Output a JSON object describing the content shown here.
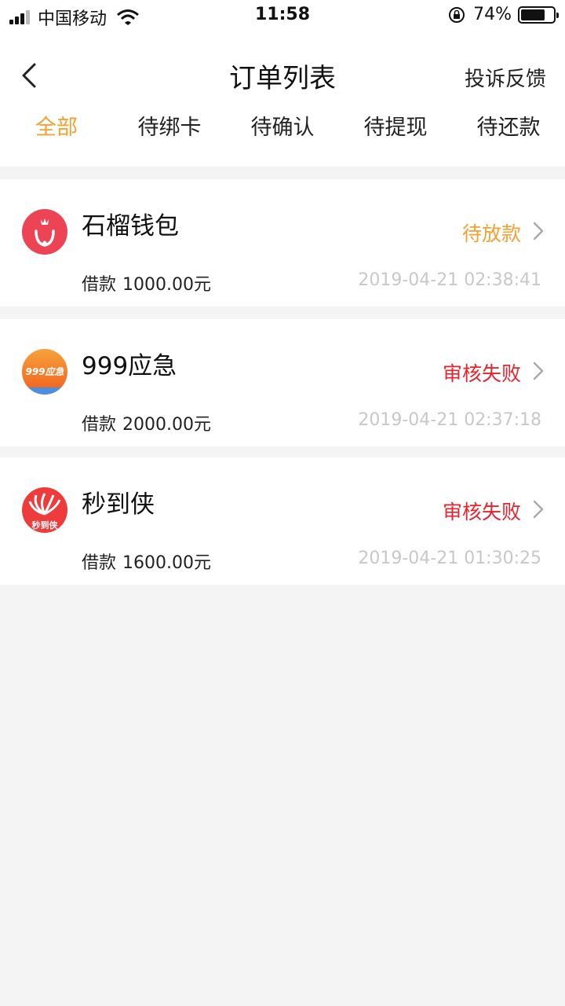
{
  "status_bar": {
    "carrier": "中国移动",
    "time": "11:58",
    "battery": "74%",
    "battery_level": 0.74
  },
  "header": {
    "title": "订单列表",
    "feedback": "投诉反馈"
  },
  "tabs": [
    {
      "label": "全部",
      "active": true
    },
    {
      "label": "待绑卡",
      "active": false
    },
    {
      "label": "待确认",
      "active": false
    },
    {
      "label": "待提现",
      "active": false
    },
    {
      "label": "待还款",
      "active": false
    }
  ],
  "orders": [
    {
      "name": "石榴钱包",
      "status": "待放款",
      "status_color": "#f5a033",
      "amount_label": "借款",
      "amount": "1000.00元",
      "time": "2019-04-21 02:38:41",
      "logo": "pomegranate-logo"
    },
    {
      "name": "999应急",
      "status": "审核失败",
      "status_color": "#e8232d",
      "amount_label": "借款",
      "amount": "2000.00元",
      "time": "2019-04-21 02:37:18",
      "logo": "999-logo",
      "logo_text": "999应急"
    },
    {
      "name": "秒到侠",
      "status": "审核失败",
      "status_color": "#e8232d",
      "amount_label": "借款",
      "amount": "1600.00元",
      "time": "2019-04-21 01:30:25",
      "logo": "miaodaoxia-logo",
      "logo_text": "秒到侠"
    }
  ],
  "colors": {
    "accent": "#f5a033",
    "fail": "#e8232d",
    "background": "#f4f4f4"
  }
}
